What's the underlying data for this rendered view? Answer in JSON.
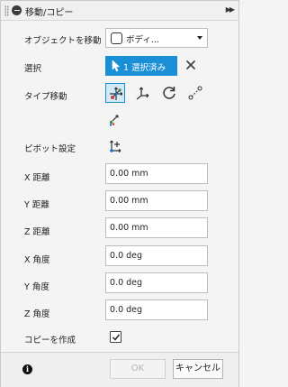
{
  "title": "移動/コピー",
  "rows": {
    "object_move": {
      "label": "オブジェクトを移動",
      "value": "ボディ..."
    },
    "selection": {
      "label": "選択",
      "button": "1 選択済み"
    },
    "move_type": {
      "label": "タイプ移動"
    },
    "pivot": {
      "label": "ピボット設定"
    },
    "x_distance": {
      "label": "X 距離",
      "value": "0.00 mm"
    },
    "y_distance": {
      "label": "Y 距離",
      "value": "0.00 mm"
    },
    "z_distance": {
      "label": "Z 距離",
      "value": "0.00 mm"
    },
    "x_angle": {
      "label": "X 角度",
      "value": "0.0 deg"
    },
    "y_angle": {
      "label": "Y 角度",
      "value": "0.0 deg"
    },
    "z_angle": {
      "label": "Z 角度",
      "value": "0.0 deg"
    },
    "create_copy": {
      "label": "コピーを作成",
      "checked": true
    }
  },
  "footer": {
    "info": "i",
    "ok": "OK",
    "cancel": "キャンセル"
  },
  "colors": {
    "accent": "#1a8fd6",
    "accent_light": "#d3e9f7",
    "panel_bg": "#f4f4f4"
  },
  "icons": {
    "collapse": "minus-circle-icon",
    "expand": "double-chevron-right-icon",
    "body": "body-icon",
    "cursor": "cursor-arrow-icon",
    "clear": "close-icon",
    "move_types": [
      "free-move-icon",
      "translate-icon",
      "rotate-icon",
      "point-to-point-icon",
      "point-to-position-icon"
    ],
    "pivot": "pivot-axes-icon",
    "checkbox": "checkmark-icon",
    "info": "info-icon"
  }
}
